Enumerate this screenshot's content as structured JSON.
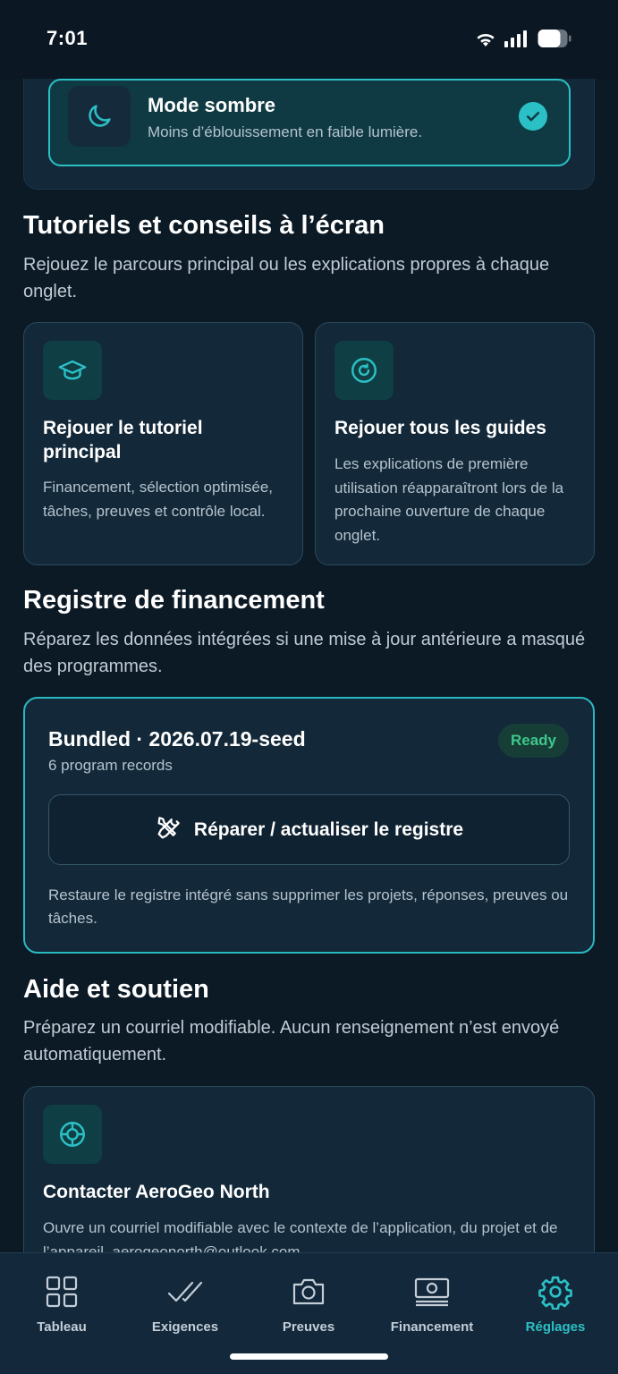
{
  "status_bar": {
    "time": "7:01"
  },
  "theme": {
    "title": "Mode sombre",
    "subtitle": "Moins d’éblouissement en faible lumière."
  },
  "tutorials": {
    "title": "Tutoriels et conseils à l’écran",
    "description": "Rejouez le parcours principal ou les explications propres à chaque onglet.",
    "cards": [
      {
        "title": "Rejouer le tutoriel principal",
        "text": "Financement, sélection optimisée, tâches, preuves et contrôle local.",
        "icon": "graduation-cap-icon"
      },
      {
        "title": "Rejouer tous les guides",
        "text": "Les explications de première utilisation réapparaîtront lors de la prochaine ouverture de chaque onglet.",
        "icon": "refresh-icon"
      }
    ]
  },
  "registry": {
    "title": "Registre de financement",
    "description": "Réparez les données intégrées si une mise à jour antérieure a masqué des programmes.",
    "bundle_title": "Bundled · 2026.07.19-seed",
    "record_count": "6 program records",
    "status_badge": "Ready",
    "repair_label": "Réparer / actualiser le registre",
    "note": "Restaure le registre intégré sans supprimer les projets, réponses, preuves ou tâches."
  },
  "help": {
    "title": "Aide et soutien",
    "description": "Préparez un courriel modifiable. Aucun renseignement n’est envoyé automatiquement.",
    "card_title": "Contacter AeroGeo North",
    "card_text": "Ouvre un courriel modifiable avec le contexte de l’application, du projet et de l’appareil. aerogeonorth@outlook.com"
  },
  "nav": {
    "items": [
      {
        "label": "Tableau",
        "icon": "grid-icon"
      },
      {
        "label": "Exigences",
        "icon": "double-check-icon"
      },
      {
        "label": "Preuves",
        "icon": "camera-icon"
      },
      {
        "label": "Financement",
        "icon": "banknote-icon"
      },
      {
        "label": "Réglages",
        "icon": "gear-icon",
        "active": true
      }
    ]
  },
  "colors": {
    "accent": "#2bc0c5",
    "background": "#0c1a26",
    "card": "#132838",
    "ready": "#3fc78d"
  }
}
